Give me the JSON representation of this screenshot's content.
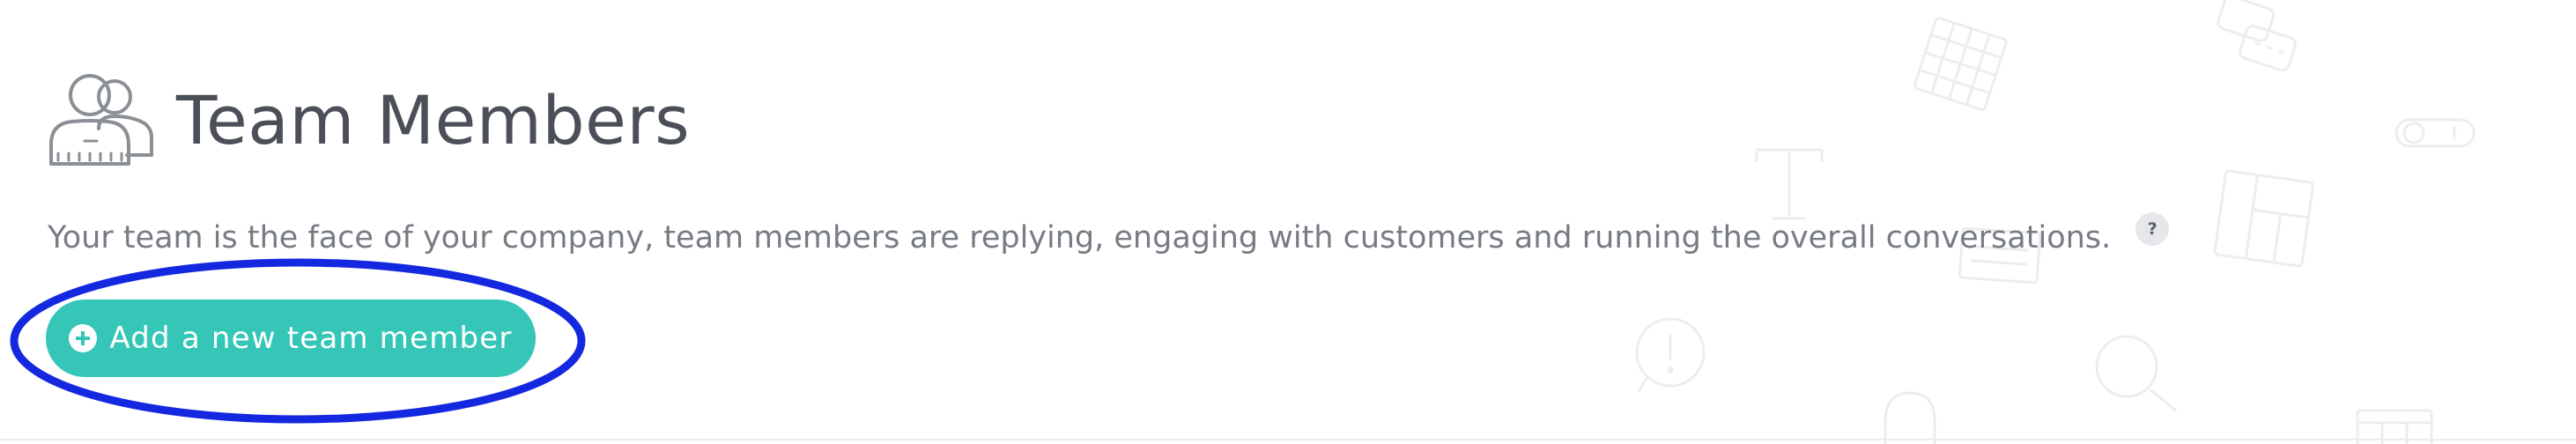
{
  "header": {
    "title": "Team Members",
    "icon": "team-members-icon"
  },
  "description": {
    "text": "Your team is the face of your company, team members are replying, engaging with customers and running the overall conversations.",
    "help_label": "?"
  },
  "actions": {
    "add_member_label": "Add a new team member",
    "add_member_icon": "plus-circle-icon"
  },
  "background_icons": [
    "grid-icon",
    "chat-bubbles-icon",
    "toggle-icon",
    "text-icon",
    "layout-icon",
    "document-icon",
    "alert-bubble-icon",
    "search-icon",
    "bell-icon",
    "table-icon"
  ],
  "colors": {
    "accent": "#35c6b8",
    "title": "#4b4f58",
    "text": "#777b84",
    "highlight": "#1428e0",
    "decor": "#ebedf0"
  }
}
